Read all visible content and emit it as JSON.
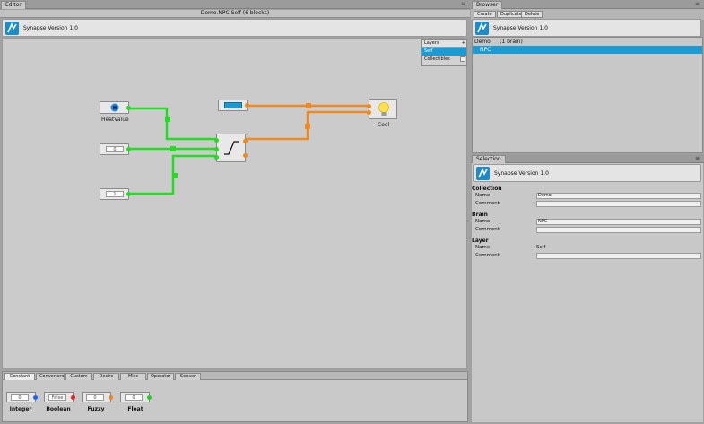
{
  "editor": {
    "tab_label": "Editor",
    "title": "Demo.NPC.Self  (6 blocks)",
    "header_title": "Synapse Version 1.0",
    "layers": {
      "header": "Layers",
      "add_label": "+",
      "items": [
        {
          "label": "Self",
          "selected": true
        },
        {
          "label": "Collectibles",
          "selected": false
        }
      ]
    },
    "nodes": {
      "heat_value_label": "HeatValue",
      "float_input": "0",
      "int_input": "1",
      "blue_input_value": "",
      "output_label": "Cool"
    }
  },
  "palette": {
    "tabs": [
      "Constant",
      "Converters",
      "Custom",
      "Desire",
      "Misc",
      "Operator",
      "Sensor"
    ],
    "active_tab": "Constant",
    "items": [
      {
        "label": "Integer",
        "input": "0",
        "port_color": "#2060ff"
      },
      {
        "label": "Boolean",
        "input": "False",
        "port_color": "#e02020"
      },
      {
        "label": "Fuzzy",
        "input": "0",
        "port_color": "#f08020"
      },
      {
        "label": "Float",
        "input": "0",
        "port_color": "#20d020"
      }
    ]
  },
  "browser": {
    "tab_label": "Browser",
    "buttons": {
      "create": "Create",
      "duplicate": "Duplicate",
      "delete": "Delete"
    },
    "header_title": "Synapse Version 1.0",
    "rows": [
      {
        "name": "Demo",
        "info": "(1 brain)",
        "selected": false
      },
      {
        "name": "NPC",
        "info": "",
        "selected": true
      }
    ]
  },
  "selection": {
    "tab_label": "Selection",
    "header_title": "Synapse Version 1.0",
    "collection": {
      "heading": "Collection",
      "name_label": "Name",
      "name_value": "Demo",
      "comment_label": "Comment",
      "comment_value": ""
    },
    "brain": {
      "heading": "Brain",
      "name_label": "Name",
      "name_value": "NPC",
      "comment_label": "Comment",
      "comment_value": ""
    },
    "layer": {
      "heading": "Layer",
      "name_label": "Name",
      "name_value": "Self",
      "comment_label": "Comment",
      "comment_value": ""
    }
  },
  "colors": {
    "green_wire": "#22dd22",
    "orange_wire": "#f08a1e",
    "accent_blue": "#1c9ad2"
  }
}
